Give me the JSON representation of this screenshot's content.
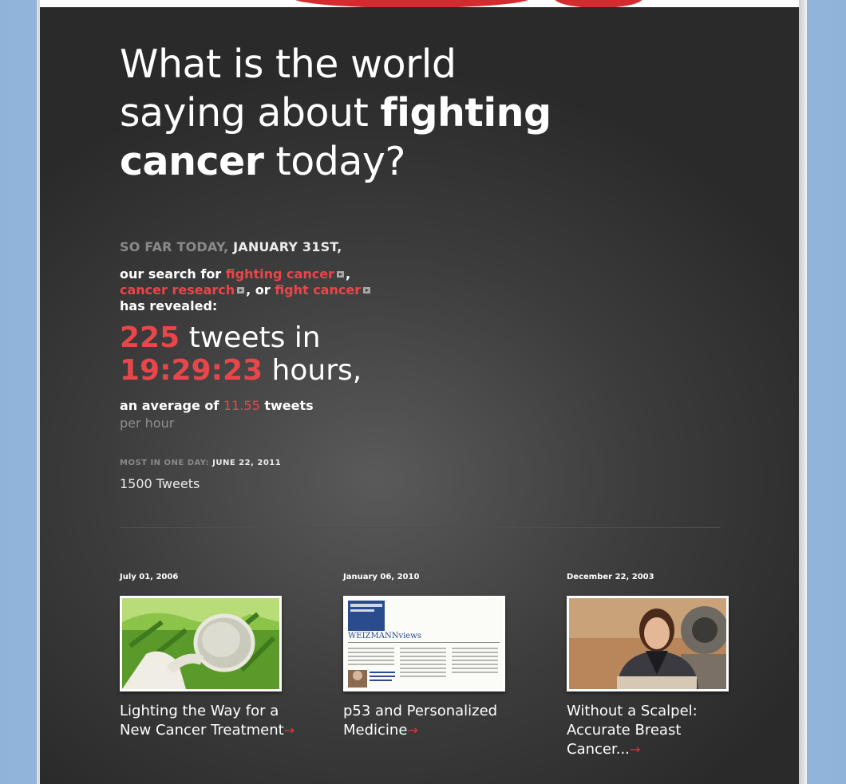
{
  "headline": {
    "part1": "What is the world saying about ",
    "bold1": "fighting cancer",
    "part2": " today?"
  },
  "summary": {
    "prefix": "SO FAR TODAY,",
    "date": "JANUARY 31ST,",
    "search_intro": "our search for",
    "term1": "fighting cancer",
    "sep1": ",",
    "term2": "cancer research",
    "sep2": ", or",
    "term3": "fight cancer",
    "revealed": "has revealed:"
  },
  "stats": {
    "tweet_count": "225",
    "tweets_in": "tweets in",
    "duration": "19:29:23",
    "hours": "hours,",
    "avg_prefix": "an average of",
    "avg_value": "11.55",
    "avg_suffix": "tweets",
    "avg_unit": "per hour",
    "most_label": "MOST IN ONE DAY:",
    "most_date": "JUNE 22, 2011",
    "most_value": "1500 Tweets"
  },
  "articles": [
    {
      "date": "July 01, 2006",
      "title": "Lighting the Way for a New Cancer Treatment",
      "image": "petri-dish-photo"
    },
    {
      "date": "January 06, 2010",
      "title": "p53 and Personalized Medicine",
      "image": "weizmann-views-newsletter"
    },
    {
      "date": "December 22, 2003",
      "title": "Without a Scalpel: Accurate Breast Cancer...",
      "image": "scientist-portrait"
    }
  ],
  "thumb_text": {
    "newsletter_brand": "WEIZMANNviews"
  },
  "colors": {
    "accent": "#e8464a",
    "background": "#3c3c3c",
    "ribbon": "#d42b2e"
  }
}
